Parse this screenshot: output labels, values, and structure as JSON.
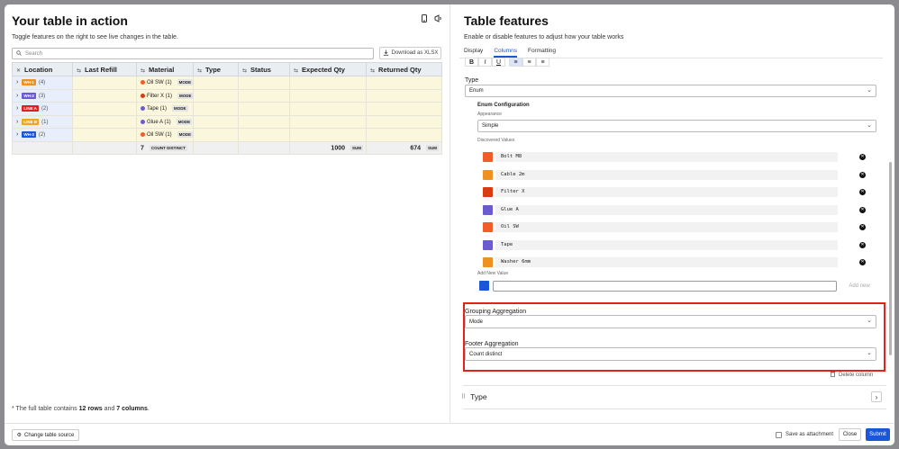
{
  "left": {
    "title": "Your table in action",
    "subtitle": "Toggle features on the right to see live changes in the table.",
    "search_placeholder": "Search",
    "download_label": "Download as XLSX",
    "columns": [
      "Location",
      "Last Refill",
      "Material",
      "Type",
      "Status",
      "Expected Qty",
      "Returned Qty"
    ],
    "rows": [
      {
        "tag": "WH-1",
        "tag_color": "#f0901e",
        "count": "(4)",
        "material": "Oil SW (1)",
        "dot": "#f25c2a",
        "mode": "MODE"
      },
      {
        "tag": "WH-2",
        "tag_color": "#6b5bd2",
        "count": "(3)",
        "material": "Filter X (1)",
        "dot": "#d93b12",
        "mode": "MODE"
      },
      {
        "tag": "LINE A",
        "tag_color": "#d92222",
        "count": "(2)",
        "material": "Tape (1)",
        "dot": "#6b5bd2",
        "mode": "MODE"
      },
      {
        "tag": "LINE B",
        "tag_color": "#f0a51e",
        "count": "(1)",
        "material": "Glue A (1)",
        "dot": "#6b5bd2",
        "mode": "MODE"
      },
      {
        "tag": "WH-3",
        "tag_color": "#1a57d6",
        "count": "(2)",
        "material": "Oil SW (1)",
        "dot": "#f25c2a",
        "mode": "MODE"
      }
    ],
    "footer": {
      "material_count": "7",
      "material_agg": "COUNT DISTINCT",
      "expected": "1000",
      "expected_agg": "SUM",
      "returned": "674",
      "returned_agg": "SUM"
    },
    "note_prefix": "* The full table contains ",
    "note_rows": "12 rows",
    "note_mid": " and ",
    "note_cols": "7 columns",
    "note_suffix": "."
  },
  "right": {
    "title": "Table features",
    "subtitle": "Enable or disable features to adjust how your table works",
    "tabs": [
      "Display",
      "Columns",
      "Formatting"
    ],
    "type_label": "Type",
    "type_value": "Enum",
    "enum_config": "Enum Configuration",
    "appearance_label": "Appearance",
    "appearance_value": "Simple",
    "discovered_label": "Discovered Values",
    "values": [
      {
        "name": "Bolt M8",
        "color": "#f25c2a"
      },
      {
        "name": "Cable 2m",
        "color": "#f0901e"
      },
      {
        "name": "Filter X",
        "color": "#d93b12"
      },
      {
        "name": "Glue A",
        "color": "#6b5bd2"
      },
      {
        "name": "Oil SW",
        "color": "#f25c2a"
      },
      {
        "name": "Tape",
        "color": "#6b5bd2"
      },
      {
        "name": "Washer 6mm",
        "color": "#f0901e"
      }
    ],
    "add_new_label": "Add New Value",
    "add_new_button": "Add new",
    "grouping_label": "Grouping Aggregation",
    "grouping_value": "Mode",
    "footer_agg_label": "Footer Aggregation",
    "footer_agg_value": "Count distinct",
    "delete_column": "Delete column",
    "next_section": "Type"
  },
  "footer": {
    "change_source": "Change table source",
    "save_attachment": "Save as attachment",
    "close": "Close",
    "submit": "Submit"
  }
}
